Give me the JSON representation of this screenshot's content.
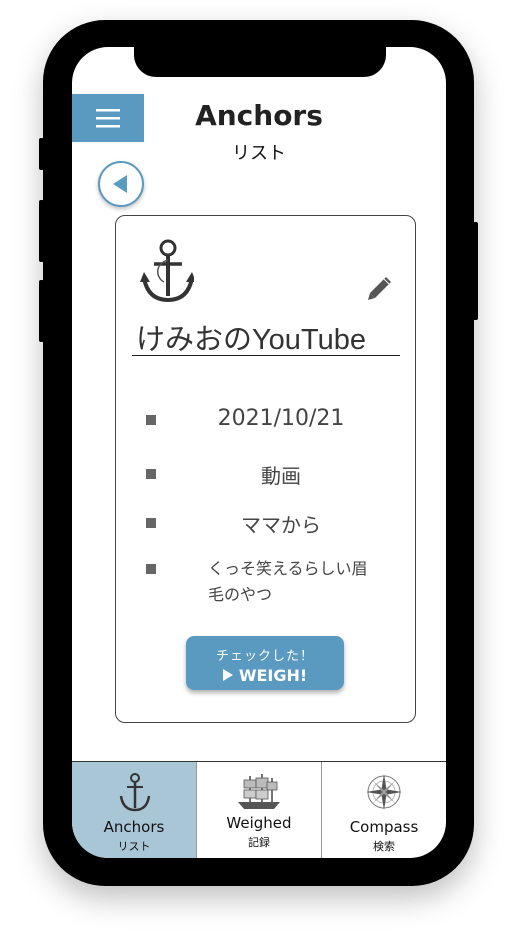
{
  "header": {
    "title": "Anchors",
    "subtitle": "リスト"
  },
  "card": {
    "title": "けみおのYouTube",
    "details": [
      "2021/10/21",
      "動画",
      "ママから",
      "くっそ笑えるらしい眉毛のやつ"
    ],
    "weigh_button": {
      "sublabel": "チェックした！",
      "label": "WEIGH!"
    }
  },
  "tabbar": {
    "tabs": [
      {
        "label": "Anchors",
        "sub": "リスト",
        "icon": "anchor-icon",
        "active": true
      },
      {
        "label": "Weighed",
        "sub": "記録",
        "icon": "ship-icon",
        "active": false
      },
      {
        "label": "Compass",
        "sub": "検索",
        "icon": "compass-icon",
        "active": false
      }
    ]
  },
  "colors": {
    "accent": "#5b9ac0",
    "active_tab": "#a9c6d6"
  }
}
